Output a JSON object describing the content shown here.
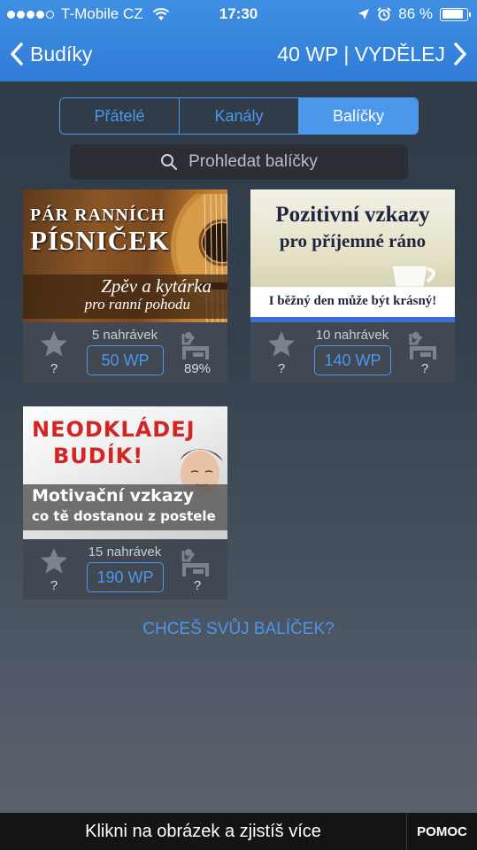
{
  "status_bar": {
    "carrier": "T-Mobile CZ",
    "time": "17:30",
    "battery": "86 %",
    "battery_level": 0.86,
    "signal_bars": 4,
    "icons": [
      "wifi-icon",
      "location-arrow-icon",
      "alarm-clock-icon",
      "battery-icon"
    ]
  },
  "nav": {
    "back_label": "Budíky",
    "right_label": "40 WP | VYDĚLEJ"
  },
  "tabs": [
    {
      "label": "Přátelé",
      "active": false
    },
    {
      "label": "Kanály",
      "active": false
    },
    {
      "label": "Balíčky",
      "active": true
    }
  ],
  "search": {
    "placeholder": "Prohledat balíčky"
  },
  "packages": [
    {
      "image_lines": [
        "PÁR RANNÍCH",
        "PÍSNIČEK",
        "Zpěv a kytárka",
        "pro ranní pohodu"
      ],
      "rating": "?",
      "recordings": "5 nahrávek",
      "price": "50 WP",
      "wake_rate": "89%"
    },
    {
      "image_lines": [
        "Pozitivní vzkazy",
        "pro příjemné ráno",
        "I běžný den může být krásný!"
      ],
      "rating": "?",
      "recordings": "10 nahrávek",
      "price": "140 WP",
      "wake_rate": "?"
    },
    {
      "image_lines": [
        "NEODKLÁDEJ",
        "BUDÍK!",
        "Motivační vzkazy",
        "co tě dostanou z postele"
      ],
      "rating": "?",
      "recordings": "15 nahrávek",
      "price": "190 WP",
      "wake_rate": "?"
    }
  ],
  "cta": "CHCEŠ SVŮJ BALÍČEK?",
  "bottom_bar": {
    "text": "Klikni na obrázek a zjistíš více",
    "help": "POMOC"
  },
  "colors": {
    "accent": "#4a97ec",
    "header": "#2f7cd8",
    "card_footer": "#424852"
  }
}
